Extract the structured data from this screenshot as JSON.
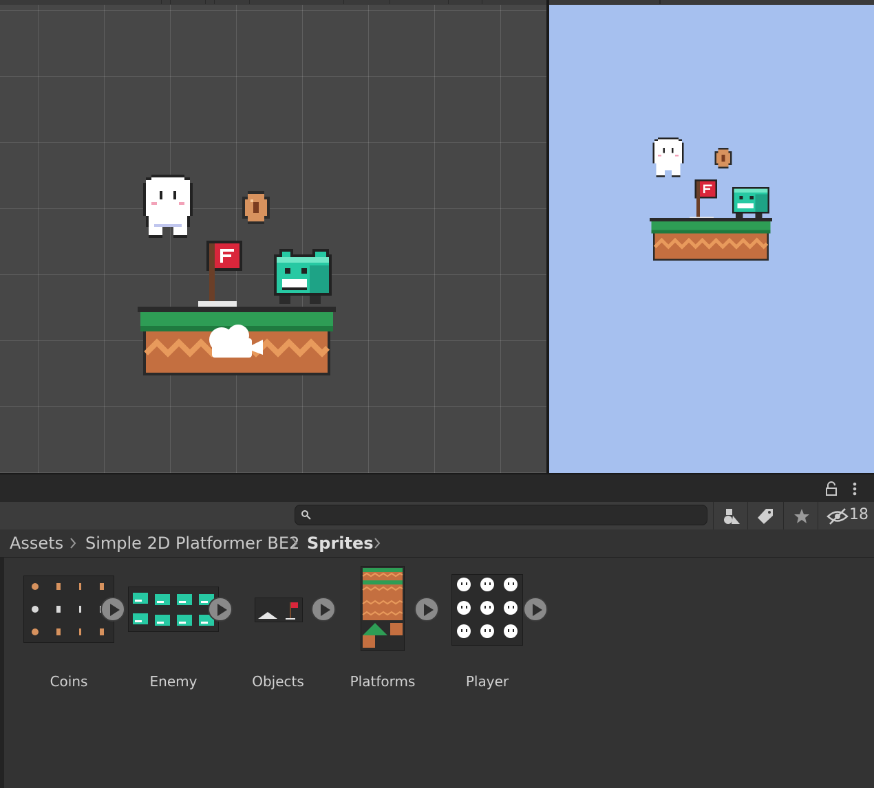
{
  "project_panel": {
    "search": {
      "placeholder": ""
    },
    "hidden_packages_count": "18",
    "breadcrumb": [
      "Assets",
      "Simple 2D Platformer BE2",
      "Sprites"
    ],
    "assets": [
      {
        "label": "Coins"
      },
      {
        "label": "Enemy"
      },
      {
        "label": "Objects"
      },
      {
        "label": "Platforms"
      },
      {
        "label": "Player"
      }
    ]
  },
  "icons": {
    "search": "search-icon",
    "lock": "lock-icon",
    "kebab": "more-options-icon",
    "type_filter": "shapes-icon",
    "label_filter": "tag-icon",
    "favorite": "star-icon",
    "hidden_packages": "eye-slash-icon",
    "camera_gizmo": "camera-icon"
  },
  "colors": {
    "scene_bg": "#474747",
    "game_bg": "#a6c0ef",
    "grass": "#2e9d55",
    "dirt": "#c46f40",
    "enemy": "#27c9a3",
    "flag": "#d9263b"
  }
}
